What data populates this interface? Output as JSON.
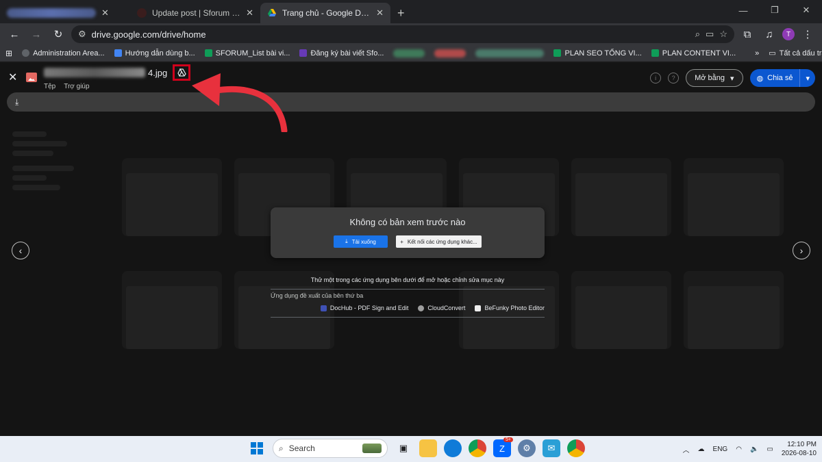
{
  "tabs": [
    {
      "title": "",
      "active": false
    },
    {
      "title": "Update post | Sforum CMS",
      "active": false
    },
    {
      "title": "Trang chủ - Google Drive",
      "active": true
    }
  ],
  "address": {
    "url": "drive.google.com/drive/home",
    "profile_initial": "T"
  },
  "bookmarks": [
    {
      "label": "Administration Area...",
      "color": "#5f6368"
    },
    {
      "label": "Hướng dẫn dùng b...",
      "color": "#4285f4"
    },
    {
      "label": "SFORUM_List bài vi...",
      "color": "#0f9d58"
    },
    {
      "label": "Đăng ký bài viết Sfo...",
      "color": "#673ab7"
    },
    {
      "label": "PLAN SEO TỔNG VI...",
      "color": "#0f9d58"
    },
    {
      "label": "PLAN CONTENT VI...",
      "color": "#0f9d58"
    }
  ],
  "bookmarks_all": "Tất cả dấu trang",
  "viewer": {
    "file_ext": "4.jpg",
    "menu": [
      "Tệp",
      "Trợ giúp"
    ],
    "open_with": "Mở bằng",
    "share": "Chia sẻ"
  },
  "no_preview": {
    "title": "Không có bản xem trước nào",
    "download": "Tải xuống",
    "connect": "Kết nối các ứng dụng khác..."
  },
  "apps": {
    "lead": "Thử một trong các ứng dụng bên dưới để mở hoặc chỉnh sửa mục này",
    "sub": "Ứng dụng đề xuất của bên thứ ba",
    "items": [
      {
        "name": "DocHub - PDF Sign and Edit",
        "color": "#3f51b5"
      },
      {
        "name": "CloudConvert",
        "color": "#9e9e9e"
      },
      {
        "name": "BeFunky Photo Editor",
        "color": "#eeeeee"
      }
    ]
  },
  "taskbar": {
    "search": "Search",
    "zalo_badge": "5+",
    "lang": "ENG",
    "time": "12:10 PM",
    "date": "2026-08-10"
  },
  "colors": {
    "share_blue": "#0b57d0",
    "highlight_red": "#d0021b",
    "arrow_red": "#e8313d"
  }
}
